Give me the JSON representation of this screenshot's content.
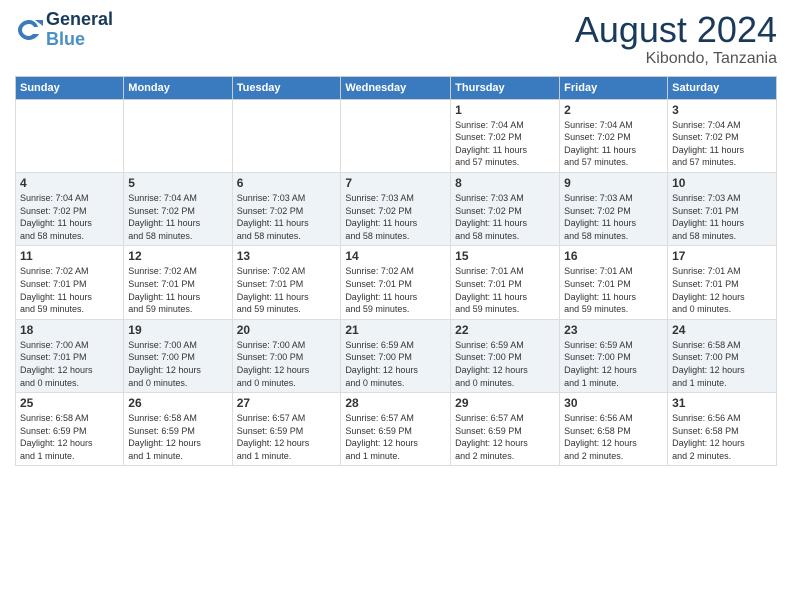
{
  "header": {
    "logo_line1": "General",
    "logo_line2": "Blue",
    "month_year": "August 2024",
    "location": "Kibondo, Tanzania"
  },
  "days_of_week": [
    "Sunday",
    "Monday",
    "Tuesday",
    "Wednesday",
    "Thursday",
    "Friday",
    "Saturday"
  ],
  "weeks": [
    {
      "days": [
        {
          "num": "",
          "info": ""
        },
        {
          "num": "",
          "info": ""
        },
        {
          "num": "",
          "info": ""
        },
        {
          "num": "",
          "info": ""
        },
        {
          "num": "1",
          "info": "Sunrise: 7:04 AM\nSunset: 7:02 PM\nDaylight: 11 hours\nand 57 minutes."
        },
        {
          "num": "2",
          "info": "Sunrise: 7:04 AM\nSunset: 7:02 PM\nDaylight: 11 hours\nand 57 minutes."
        },
        {
          "num": "3",
          "info": "Sunrise: 7:04 AM\nSunset: 7:02 PM\nDaylight: 11 hours\nand 57 minutes."
        }
      ]
    },
    {
      "days": [
        {
          "num": "4",
          "info": "Sunrise: 7:04 AM\nSunset: 7:02 PM\nDaylight: 11 hours\nand 58 minutes."
        },
        {
          "num": "5",
          "info": "Sunrise: 7:04 AM\nSunset: 7:02 PM\nDaylight: 11 hours\nand 58 minutes."
        },
        {
          "num": "6",
          "info": "Sunrise: 7:03 AM\nSunset: 7:02 PM\nDaylight: 11 hours\nand 58 minutes."
        },
        {
          "num": "7",
          "info": "Sunrise: 7:03 AM\nSunset: 7:02 PM\nDaylight: 11 hours\nand 58 minutes."
        },
        {
          "num": "8",
          "info": "Sunrise: 7:03 AM\nSunset: 7:02 PM\nDaylight: 11 hours\nand 58 minutes."
        },
        {
          "num": "9",
          "info": "Sunrise: 7:03 AM\nSunset: 7:02 PM\nDaylight: 11 hours\nand 58 minutes."
        },
        {
          "num": "10",
          "info": "Sunrise: 7:03 AM\nSunset: 7:01 PM\nDaylight: 11 hours\nand 58 minutes."
        }
      ]
    },
    {
      "days": [
        {
          "num": "11",
          "info": "Sunrise: 7:02 AM\nSunset: 7:01 PM\nDaylight: 11 hours\nand 59 minutes."
        },
        {
          "num": "12",
          "info": "Sunrise: 7:02 AM\nSunset: 7:01 PM\nDaylight: 11 hours\nand 59 minutes."
        },
        {
          "num": "13",
          "info": "Sunrise: 7:02 AM\nSunset: 7:01 PM\nDaylight: 11 hours\nand 59 minutes."
        },
        {
          "num": "14",
          "info": "Sunrise: 7:02 AM\nSunset: 7:01 PM\nDaylight: 11 hours\nand 59 minutes."
        },
        {
          "num": "15",
          "info": "Sunrise: 7:01 AM\nSunset: 7:01 PM\nDaylight: 11 hours\nand 59 minutes."
        },
        {
          "num": "16",
          "info": "Sunrise: 7:01 AM\nSunset: 7:01 PM\nDaylight: 11 hours\nand 59 minutes."
        },
        {
          "num": "17",
          "info": "Sunrise: 7:01 AM\nSunset: 7:01 PM\nDaylight: 12 hours\nand 0 minutes."
        }
      ]
    },
    {
      "days": [
        {
          "num": "18",
          "info": "Sunrise: 7:00 AM\nSunset: 7:01 PM\nDaylight: 12 hours\nand 0 minutes."
        },
        {
          "num": "19",
          "info": "Sunrise: 7:00 AM\nSunset: 7:00 PM\nDaylight: 12 hours\nand 0 minutes."
        },
        {
          "num": "20",
          "info": "Sunrise: 7:00 AM\nSunset: 7:00 PM\nDaylight: 12 hours\nand 0 minutes."
        },
        {
          "num": "21",
          "info": "Sunrise: 6:59 AM\nSunset: 7:00 PM\nDaylight: 12 hours\nand 0 minutes."
        },
        {
          "num": "22",
          "info": "Sunrise: 6:59 AM\nSunset: 7:00 PM\nDaylight: 12 hours\nand 0 minutes."
        },
        {
          "num": "23",
          "info": "Sunrise: 6:59 AM\nSunset: 7:00 PM\nDaylight: 12 hours\nand 1 minute."
        },
        {
          "num": "24",
          "info": "Sunrise: 6:58 AM\nSunset: 7:00 PM\nDaylight: 12 hours\nand 1 minute."
        }
      ]
    },
    {
      "days": [
        {
          "num": "25",
          "info": "Sunrise: 6:58 AM\nSunset: 6:59 PM\nDaylight: 12 hours\nand 1 minute."
        },
        {
          "num": "26",
          "info": "Sunrise: 6:58 AM\nSunset: 6:59 PM\nDaylight: 12 hours\nand 1 minute."
        },
        {
          "num": "27",
          "info": "Sunrise: 6:57 AM\nSunset: 6:59 PM\nDaylight: 12 hours\nand 1 minute."
        },
        {
          "num": "28",
          "info": "Sunrise: 6:57 AM\nSunset: 6:59 PM\nDaylight: 12 hours\nand 1 minute."
        },
        {
          "num": "29",
          "info": "Sunrise: 6:57 AM\nSunset: 6:59 PM\nDaylight: 12 hours\nand 2 minutes."
        },
        {
          "num": "30",
          "info": "Sunrise: 6:56 AM\nSunset: 6:58 PM\nDaylight: 12 hours\nand 2 minutes."
        },
        {
          "num": "31",
          "info": "Sunrise: 6:56 AM\nSunset: 6:58 PM\nDaylight: 12 hours\nand 2 minutes."
        }
      ]
    }
  ]
}
